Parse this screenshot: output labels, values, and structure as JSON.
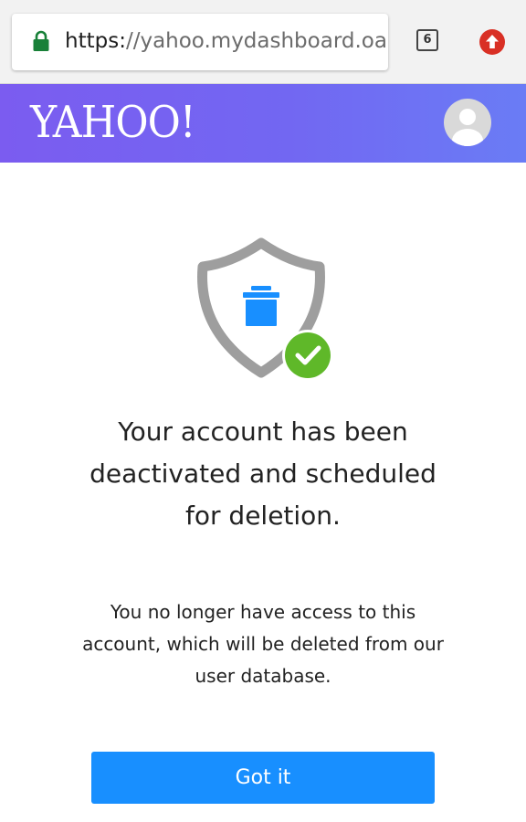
{
  "browser": {
    "url_scheme": "https:",
    "url_rest": "//yahoo.mydashboard.oath.com",
    "tab_count": "6",
    "icons": {
      "lock": "lock-icon",
      "update": "update-arrow-icon"
    },
    "colors": {
      "lock": "#188038",
      "update": "#d93025"
    }
  },
  "header": {
    "logo": "YAHOO!",
    "avatar_icon": "user-avatar-icon",
    "background_colors": [
      "#7b5cf0",
      "#6a7cf5"
    ]
  },
  "main": {
    "illustration": {
      "icons": [
        "shield-icon",
        "trash-can-icon",
        "checkmark-icon"
      ],
      "colors": {
        "shield": "#9e9e9e",
        "trash": "#188fff",
        "check": "#5fb829"
      }
    },
    "title_lines": [
      "Your account has been",
      "deactivated and scheduled",
      "for deletion."
    ],
    "body_lines": [
      "You no longer have access to this",
      "account, which will be deleted from our",
      "user database."
    ],
    "button_label": "Got it",
    "button_color": "#188fff"
  }
}
